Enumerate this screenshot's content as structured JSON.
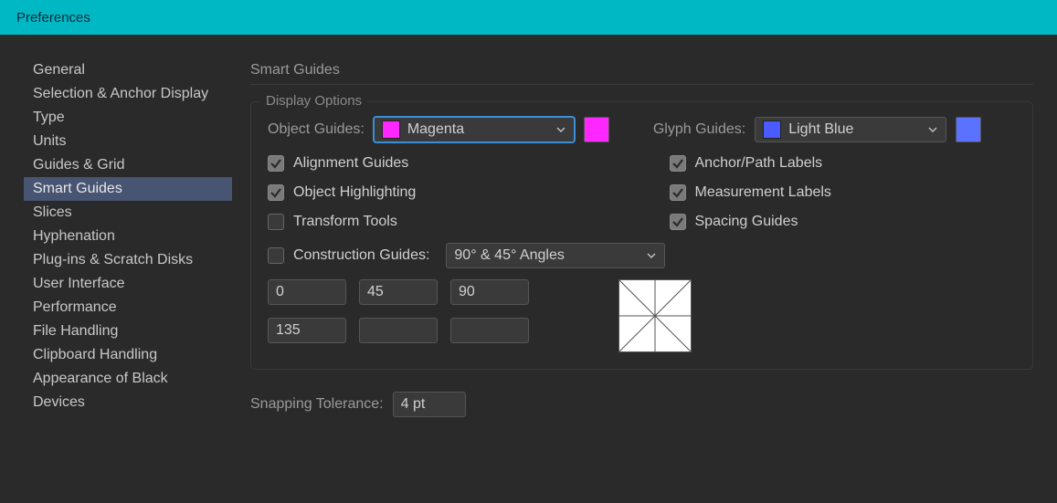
{
  "window": {
    "title": "Preferences"
  },
  "sidebar": {
    "items": [
      {
        "label": "General"
      },
      {
        "label": "Selection & Anchor Display"
      },
      {
        "label": "Type"
      },
      {
        "label": "Units"
      },
      {
        "label": "Guides & Grid"
      },
      {
        "label": "Smart Guides",
        "active": true
      },
      {
        "label": "Slices"
      },
      {
        "label": "Hyphenation"
      },
      {
        "label": "Plug-ins & Scratch Disks"
      },
      {
        "label": "User Interface"
      },
      {
        "label": "Performance"
      },
      {
        "label": "File Handling"
      },
      {
        "label": "Clipboard Handling"
      },
      {
        "label": "Appearance of Black"
      },
      {
        "label": "Devices"
      }
    ]
  },
  "page": {
    "title": "Smart Guides"
  },
  "display_options": {
    "panel_title": "Display Options",
    "object_guides": {
      "label": "Object Guides:",
      "value": "Magenta",
      "color": "#ff27ff",
      "swatch": "#ff27ff"
    },
    "glyph_guides": {
      "label": "Glyph Guides:",
      "value": "Light Blue",
      "color": "#4a5cff",
      "swatch": "#5a72ff"
    },
    "checkboxes": {
      "alignment_guides": {
        "label": "Alignment Guides",
        "checked": true
      },
      "anchor_path_labels": {
        "label": "Anchor/Path Labels",
        "checked": true
      },
      "object_highlighting": {
        "label": "Object Highlighting",
        "checked": true
      },
      "measurement_labels": {
        "label": "Measurement Labels",
        "checked": true
      },
      "transform_tools": {
        "label": "Transform Tools",
        "checked": false
      },
      "spacing_guides": {
        "label": "Spacing Guides",
        "checked": true
      },
      "construction_guides": {
        "label": "Construction Guides:",
        "checked": false
      }
    },
    "construction_select": {
      "value": "90° & 45° Angles"
    },
    "angles": [
      "0",
      "45",
      "90",
      "135",
      "",
      ""
    ]
  },
  "snapping": {
    "label": "Snapping Tolerance:",
    "value": "4 pt"
  }
}
